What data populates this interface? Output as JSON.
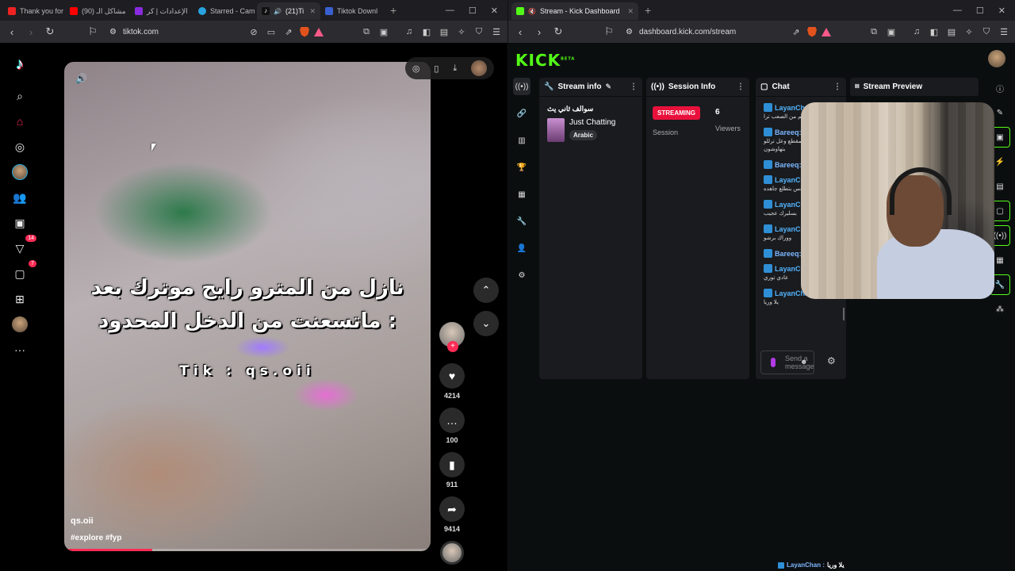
{
  "left": {
    "tabs": [
      {
        "label": "Thank you for",
        "color": "#e22"
      },
      {
        "label": "(90) مشاكل الـ",
        "color": "#f00"
      },
      {
        "label": "الإعدادات | كر",
        "color": "#8a2be2"
      },
      {
        "label": "Starred - Cam",
        "color": "#29a3e0"
      },
      {
        "label": "(21)Ti",
        "color": "#111"
      },
      {
        "label": "Tiktok Downl",
        "color": "#3a5fd0"
      }
    ],
    "url": "tiktok.com",
    "video": {
      "line1": "نازل من المترو رايح موترك بعد",
      "line2": "ماتسعنت من الدخل المحدود :",
      "line3": "Tik : qs.oii",
      "author": "qs.oii",
      "tags": "#explore #fyp",
      "progress_percent": 24
    },
    "sidebar_badges": {
      "activity": "14",
      "messages": "7"
    },
    "actions": {
      "likes": "4214",
      "comments": "100",
      "saves": "911",
      "shares": "9414"
    }
  },
  "right": {
    "tab": {
      "label": "Stream - Kick Dashboard",
      "color": "#53fc18"
    },
    "url": "dashboard.kick.com/stream",
    "logo": "KICK",
    "logo_badge": "BETA",
    "stream_info": {
      "header": "Stream info",
      "title": "سوالف ثاني يث",
      "category": "Just Chatting",
      "language": "Arabic"
    },
    "session_info": {
      "header": "Session Info",
      "status": "STREAMING",
      "viewers": "6",
      "session_label": "Session",
      "viewers_label": "Viewers"
    },
    "chat": {
      "header": "Chat",
      "messages": [
        {
          "user": "LayanChan:",
          "text": "عم من الصعب ترا"
        },
        {
          "user": "Bareeq:",
          "text": "لحس المقطع وعل ترللو بتهاوشون"
        },
        {
          "user": "Bareeq:",
          "text": ""
        },
        {
          "user": "LayanC",
          "text": "ساعه لحس بتطلع جاهده"
        },
        {
          "user": "LayanC",
          "text": "بسليرك عجيب"
        },
        {
          "user": "LayanC",
          "text": "ووراك برشو"
        },
        {
          "user": "Bareeq:",
          "text": ""
        },
        {
          "user": "LayanChan:",
          "text": "عادي توري"
        },
        {
          "user": "LayanChan:",
          "text": "يلا وريا"
        }
      ],
      "input_placeholder": "Send a message"
    },
    "preview_header": "Stream Preview",
    "ticker": {
      "user": "LayanChan :",
      "text": "يلا وريا"
    }
  },
  "window_controls": {
    "minimize": "—",
    "maximize": "☐",
    "close": "✕"
  }
}
